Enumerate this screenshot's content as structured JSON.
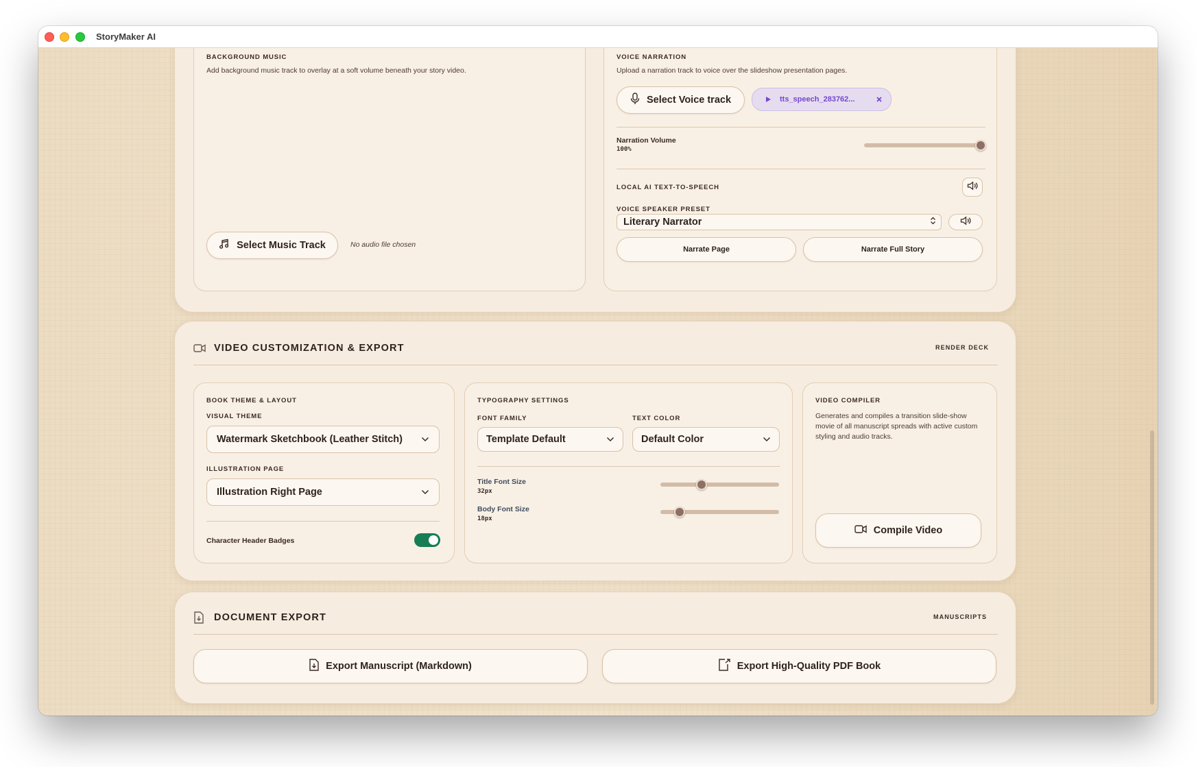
{
  "window": {
    "title": "StoryMaker AI"
  },
  "background_music": {
    "heading": "BACKGROUND MUSIC",
    "description": "Add background music track to overlay at a soft volume beneath your story video.",
    "select_button": "Select Music Track",
    "file_status": "No audio file chosen"
  },
  "voice_narration": {
    "heading": "VOICE NARRATION",
    "description": "Upload a narration track to voice over the slideshow presentation pages.",
    "select_button": "Select Voice track",
    "file_chip": "tts_speech_283762...",
    "volume_label": "Narration Volume",
    "volume_value": "100%",
    "volume_level": 1.0,
    "tts_heading": "LOCAL AI TEXT-TO-SPEECH",
    "preset_label": "VOICE SPEAKER PRESET",
    "preset_value": "Literary Narrator",
    "narrate_page": "Narrate Page",
    "narrate_full": "Narrate Full Story"
  },
  "video_section": {
    "title": "VIDEO CUSTOMIZATION & EXPORT",
    "tag": "RENDER DECK",
    "theme": {
      "heading": "BOOK THEME & LAYOUT",
      "visual_theme_label": "VISUAL THEME",
      "visual_theme_value": "Watermark Sketchbook (Leather Stitch)",
      "illustration_label": "ILLUSTRATION PAGE",
      "illustration_value": "Illustration Right Page",
      "badges_label": "Character Header Badges",
      "badges_on": true
    },
    "typography": {
      "heading": "TYPOGRAPHY SETTINGS",
      "font_family_label": "FONT FAMILY",
      "font_family_value": "Template Default",
      "text_color_label": "TEXT COLOR",
      "text_color_value": "Default Color",
      "title_size_label": "Title Font Size",
      "title_size_value": "32px",
      "title_size_level": 0.35,
      "body_size_label": "Body Font Size",
      "body_size_value": "18px",
      "body_size_level": 0.17
    },
    "compiler": {
      "heading": "VIDEO COMPILER",
      "description": "Generates and compiles a transition slide-show movie of all manuscript spreads with active custom styling and audio tracks.",
      "compile_button": "Compile Video"
    }
  },
  "document_section": {
    "title": "DOCUMENT EXPORT",
    "tag": "MANUSCRIPTS",
    "export_markdown": "Export Manuscript (Markdown)",
    "export_pdf": "Export High-Quality PDF Book"
  },
  "colors": {
    "background": "#ebd9bd",
    "card": "#f9f0e5",
    "toggle_on": "#167d54",
    "chip_text": "#7547cc",
    "slider_thumb": "#8d6f66"
  },
  "icons": [
    "music-note-icon",
    "microphone-icon",
    "play-icon",
    "close-icon",
    "speaker-icon",
    "video-camera-icon",
    "chevron-down-icon",
    "chevron-updown-icon",
    "document-download-icon",
    "document-export-icon"
  ]
}
